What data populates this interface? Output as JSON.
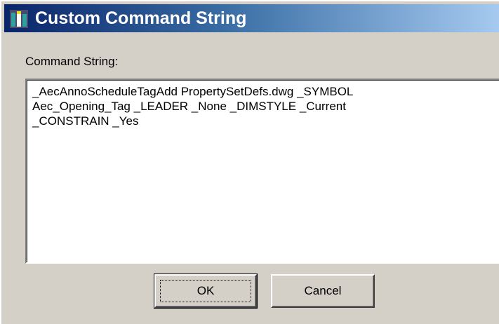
{
  "window": {
    "title": "Custom Command String",
    "icon": "app-icon"
  },
  "form": {
    "label": "Command String:",
    "value": "_AecAnnoScheduleTagAdd PropertySetDefs.dwg _SYMBOL\nAec_Opening_Tag _LEADER _None _DIMSTYLE _Current\n_CONSTRAIN _Yes"
  },
  "buttons": {
    "ok_label": "OK",
    "cancel_label": "Cancel"
  },
  "colors": {
    "titlebar_start": "#0a246a",
    "titlebar_end": "#a6caf0",
    "dialog_face": "#d4d0c8"
  }
}
